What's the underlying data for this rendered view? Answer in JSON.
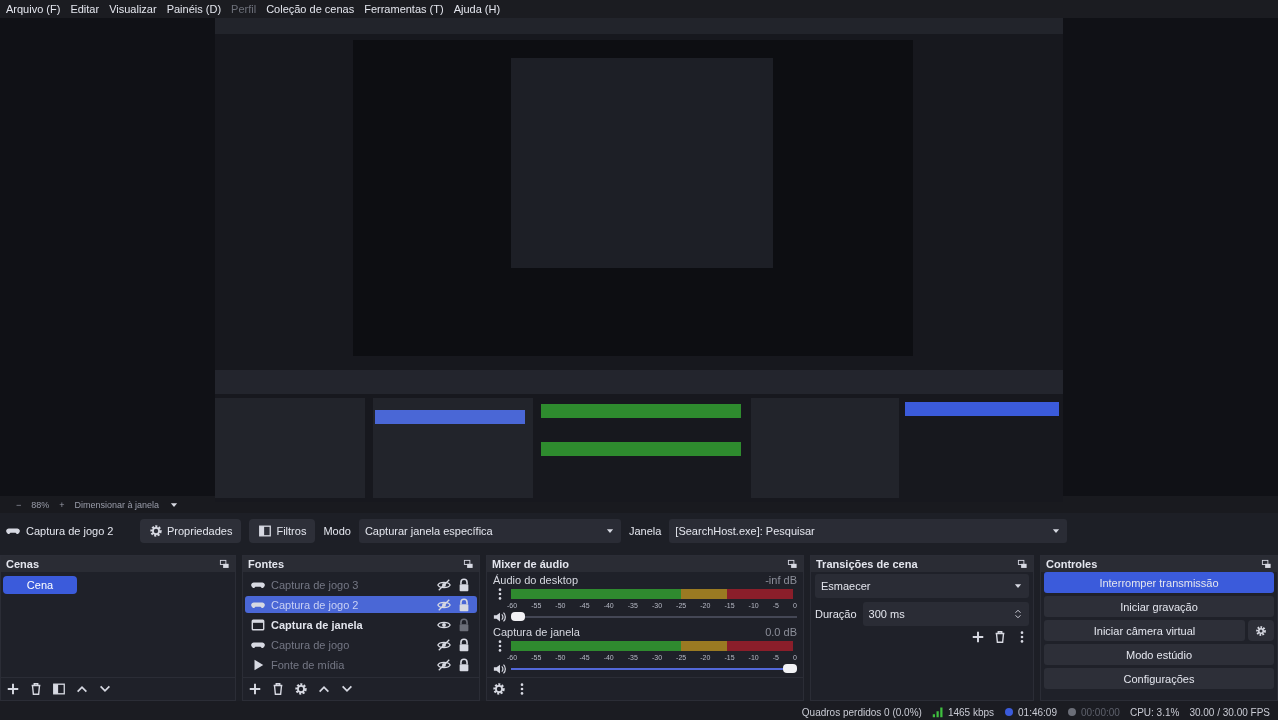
{
  "menu": [
    {
      "label": "Arquivo (F)",
      "disabled": false
    },
    {
      "label": "Editar",
      "disabled": false
    },
    {
      "label": "Visualizar",
      "disabled": false
    },
    {
      "label": "Painéis (D)",
      "disabled": false
    },
    {
      "label": "Perfil",
      "disabled": true
    },
    {
      "label": "Coleção de cenas",
      "disabled": false
    },
    {
      "label": "Ferramentas (T)",
      "disabled": false
    },
    {
      "label": "Ajuda (H)",
      "disabled": false
    }
  ],
  "zoom_bar": {
    "minus": "−",
    "zoom": "88%",
    "plus": "+",
    "fit": "Dimensionar à janela"
  },
  "source_bar": {
    "source": "Captura de jogo 2",
    "properties": "Propriedades",
    "filters": "Filtros",
    "mode_label": "Modo",
    "mode": "Capturar janela específica",
    "window_label": "Janela",
    "window": "[SearchHost.exe]: Pesquisar"
  },
  "scenes": {
    "title": "Cenas",
    "items": [
      {
        "label": "Cena",
        "selected": true
      }
    ]
  },
  "sources": {
    "title": "Fontes",
    "items": [
      {
        "label": "Captura de jogo 3",
        "kind": "game",
        "visible": false,
        "locked": true,
        "selected": false
      },
      {
        "label": "Captura de jogo 2",
        "kind": "game",
        "visible": false,
        "locked": true,
        "selected": true
      },
      {
        "label": "Captura de janela",
        "kind": "window",
        "visible": true,
        "locked": false,
        "selected": false
      },
      {
        "label": "Captura de jogo",
        "kind": "game",
        "visible": false,
        "locked": true,
        "selected": false
      },
      {
        "label": "Fonte de mídia",
        "kind": "media",
        "visible": false,
        "locked": true,
        "selected": false
      }
    ]
  },
  "mixer": {
    "title": "Mixer de áudio",
    "channels": [
      {
        "name": "Áudio do desktop",
        "reading": "-inf dB",
        "level": 0,
        "ticks": [
          "-60",
          "-55",
          "-50",
          "-45",
          "-40",
          "-35",
          "-30",
          "-25",
          "-20",
          "-15",
          "-10",
          "-5",
          "0"
        ]
      },
      {
        "name": "Captura de janela",
        "reading": "0.0 dB",
        "level": 1,
        "ticks": [
          "-60",
          "-55",
          "-50",
          "-45",
          "-40",
          "-35",
          "-30",
          "-25",
          "-20",
          "-15",
          "-10",
          "-5",
          "0"
        ]
      }
    ]
  },
  "transitions": {
    "title": "Transições de cena",
    "transition": "Esmaecer",
    "duration_label": "Duração",
    "duration": "300 ms"
  },
  "controls": {
    "title": "Controles",
    "buttons": [
      {
        "label": "Interromper transmissão",
        "active": true,
        "has_settings": false
      },
      {
        "label": "Iniciar gravação",
        "active": false,
        "has_settings": false
      },
      {
        "label": "Iniciar câmera virtual",
        "active": false,
        "has_settings": true
      },
      {
        "label": "Modo estúdio",
        "active": false,
        "has_settings": false
      },
      {
        "label": "Configurações",
        "active": false,
        "has_settings": false
      }
    ]
  },
  "status_bar": {
    "dropped": "Quadros perdidos 0 (0.0%)",
    "bitrate": "1465 kbps",
    "stream_time": "01:46:09",
    "record_time": "00:00:00",
    "cpu": "CPU: 3.1%",
    "fps": "30.00 / 30.00 FPS"
  }
}
